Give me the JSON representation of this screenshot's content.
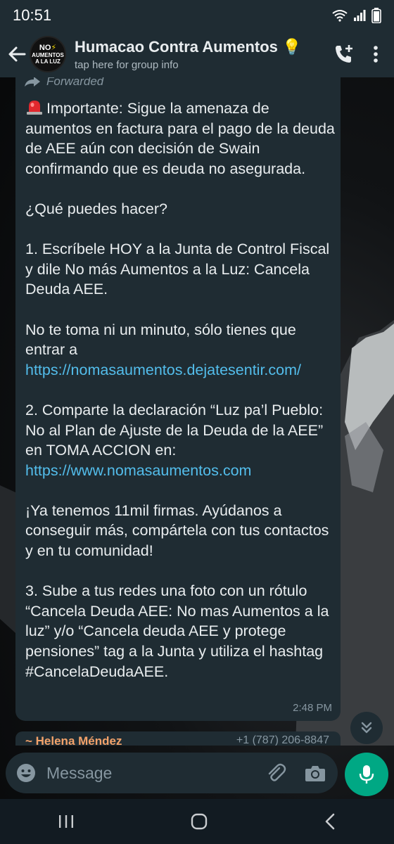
{
  "status_bar": {
    "time": "10:51"
  },
  "app_bar": {
    "title": "Humacao Contra Aumentos 💡",
    "subtitle": "tap here for group info",
    "avatar": {
      "line1_prefix": "NO",
      "line2": "AUMENTOS",
      "line3": "A LA LUZ"
    }
  },
  "message": {
    "forwarded_label": "Forwarded",
    "para1": "Importante: Sigue la amenaza de aumentos en factura para el pago de la deuda de AEE aún con decisión de Swain confirmando que es deuda no asegurada.",
    "para2": "¿Qué puedes hacer?",
    "para3": "1. Escríbele HOY a la Junta de Control Fiscal y dile No más Aumentos a la Luz: Cancela Deuda AEE.",
    "para4_text": "No te toma ni un minuto, sólo tienes que entrar a ",
    "para4_link": "https://nomasaumentos.dejatesentir.com/",
    "para5_text": "2. Comparte la declaración “Luz pa’l Pueblo: No al Plan de Ajuste de la Deuda de la AEE” en TOMA ACCION en: ",
    "para5_link": "https://www.nomasaumentos.com",
    "para6": "¡Ya tenemos 11mil firmas. Ayúdanos a conseguir más, compártela con tus contactos y en tu comunidad!",
    "para7": "3. Sube a tus redes una foto con un rótulo  “Cancela Deuda AEE: No mas Aumentos a la luz” y/o “Cancela deuda AEE y protege pensiones” tag a la Junta y utiliza el hashtag #CancelaDeudaAEE.",
    "time": "2:48 PM"
  },
  "next_message": {
    "sender": "~ Helena Méndez",
    "phone": "+1 (787) 206-8847"
  },
  "composer": {
    "placeholder": "Message"
  },
  "colors": {
    "header_bg": "#1f2c33",
    "bubble_bg": "#1f2c33",
    "link": "#53bdeb",
    "accent": "#00a884"
  }
}
